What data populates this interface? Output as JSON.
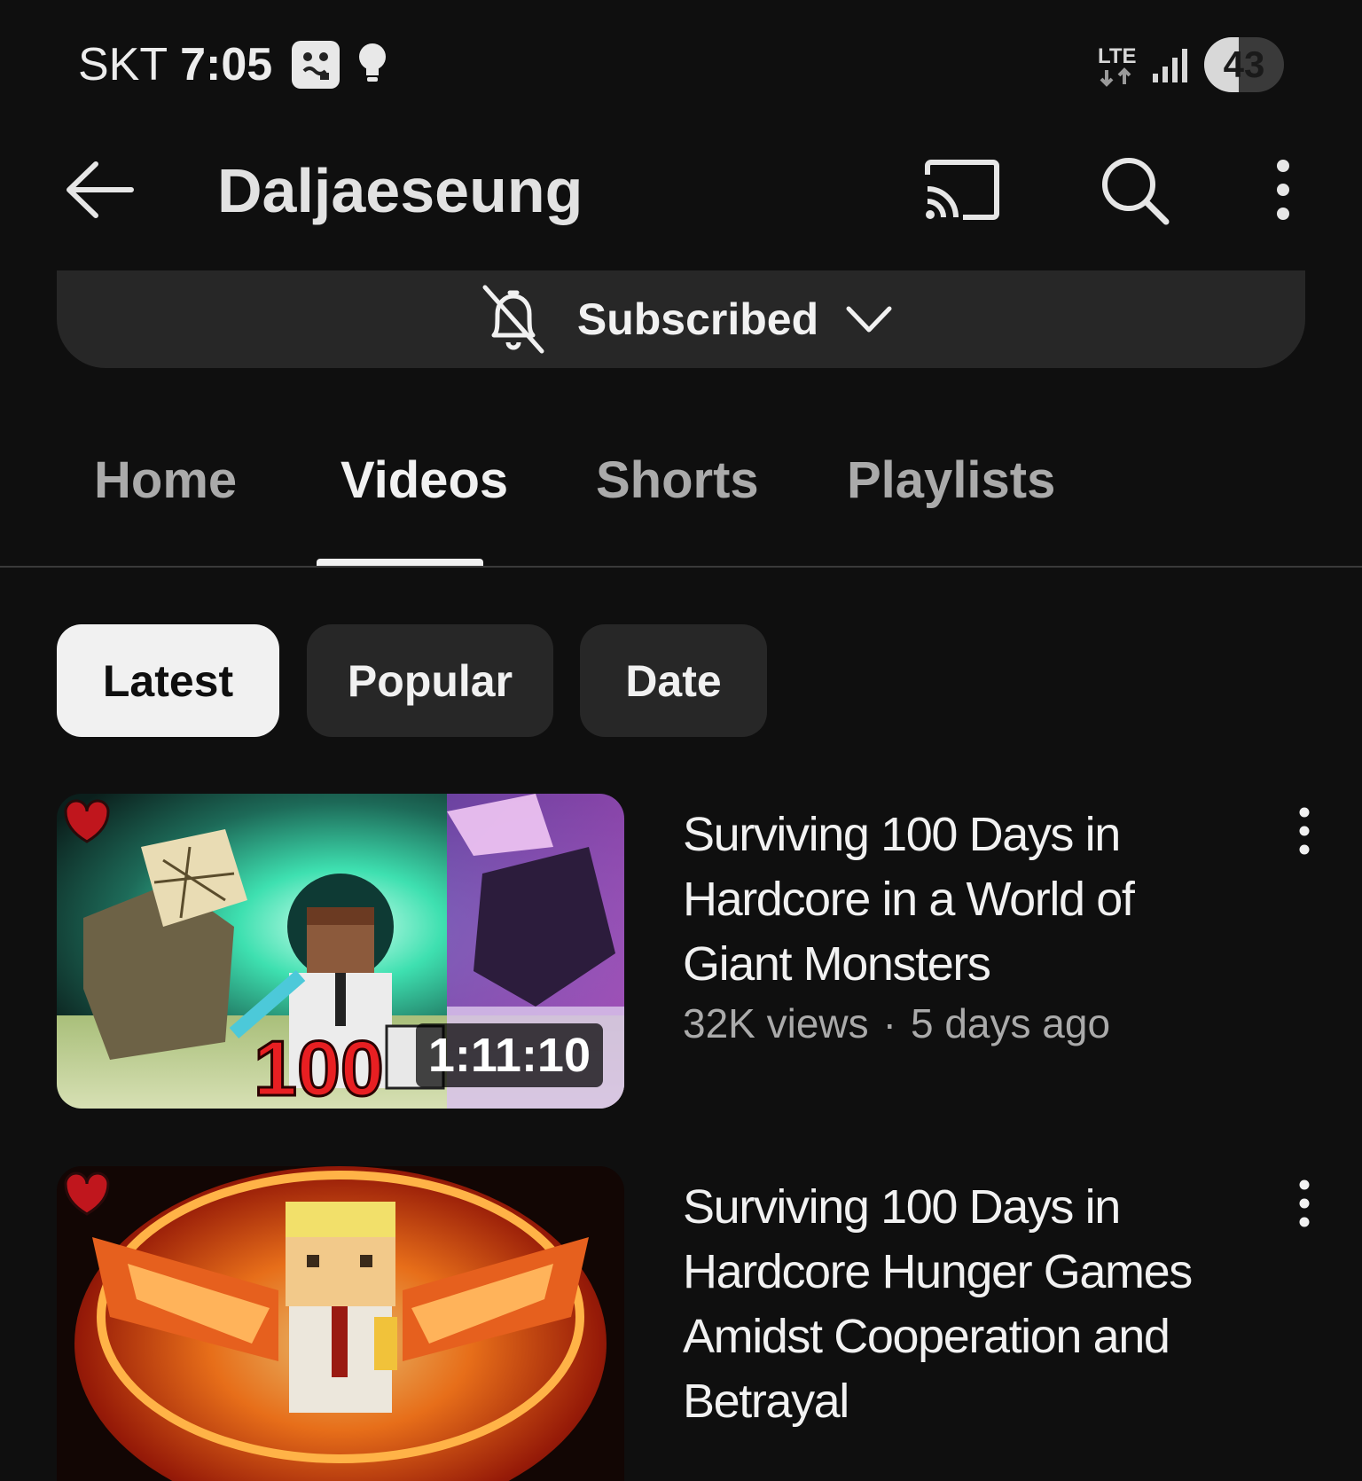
{
  "status_bar": {
    "carrier": "SKT",
    "time": "7:05",
    "network": "LTE",
    "battery": "43",
    "battery_level": 0.43
  },
  "header": {
    "channel_name": "Daljaeseung",
    "icons": {
      "back": "arrow-left-icon",
      "cast": "cast-icon",
      "search": "search-icon",
      "more": "more-vert-icon"
    }
  },
  "subscribe": {
    "label": "Subscribed",
    "icon": "bell-off-icon"
  },
  "tabs": [
    {
      "label": "Home",
      "active": false
    },
    {
      "label": "Videos",
      "active": true
    },
    {
      "label": "Shorts",
      "active": false
    },
    {
      "label": "Playlists",
      "active": false
    }
  ],
  "filters": [
    {
      "label": "Latest",
      "selected": true
    },
    {
      "label": "Popular",
      "selected": false
    },
    {
      "label": "Date",
      "selected": false
    }
  ],
  "videos": [
    {
      "title": "Surviving 100 Days in Hardcore in a World of Giant Monsters",
      "views": "32K views",
      "age": "5 days ago",
      "duration": "1:11:10",
      "thumb_text": "100"
    },
    {
      "title": "Surviving 100 Days in Hardcore Hunger Games Amidst Cooperation and Betrayal"
    }
  ],
  "colors": {
    "background": "#0f0f0f",
    "chip": "#272727",
    "text_primary": "#f1f1f1",
    "text_secondary": "#aaaaaa"
  }
}
